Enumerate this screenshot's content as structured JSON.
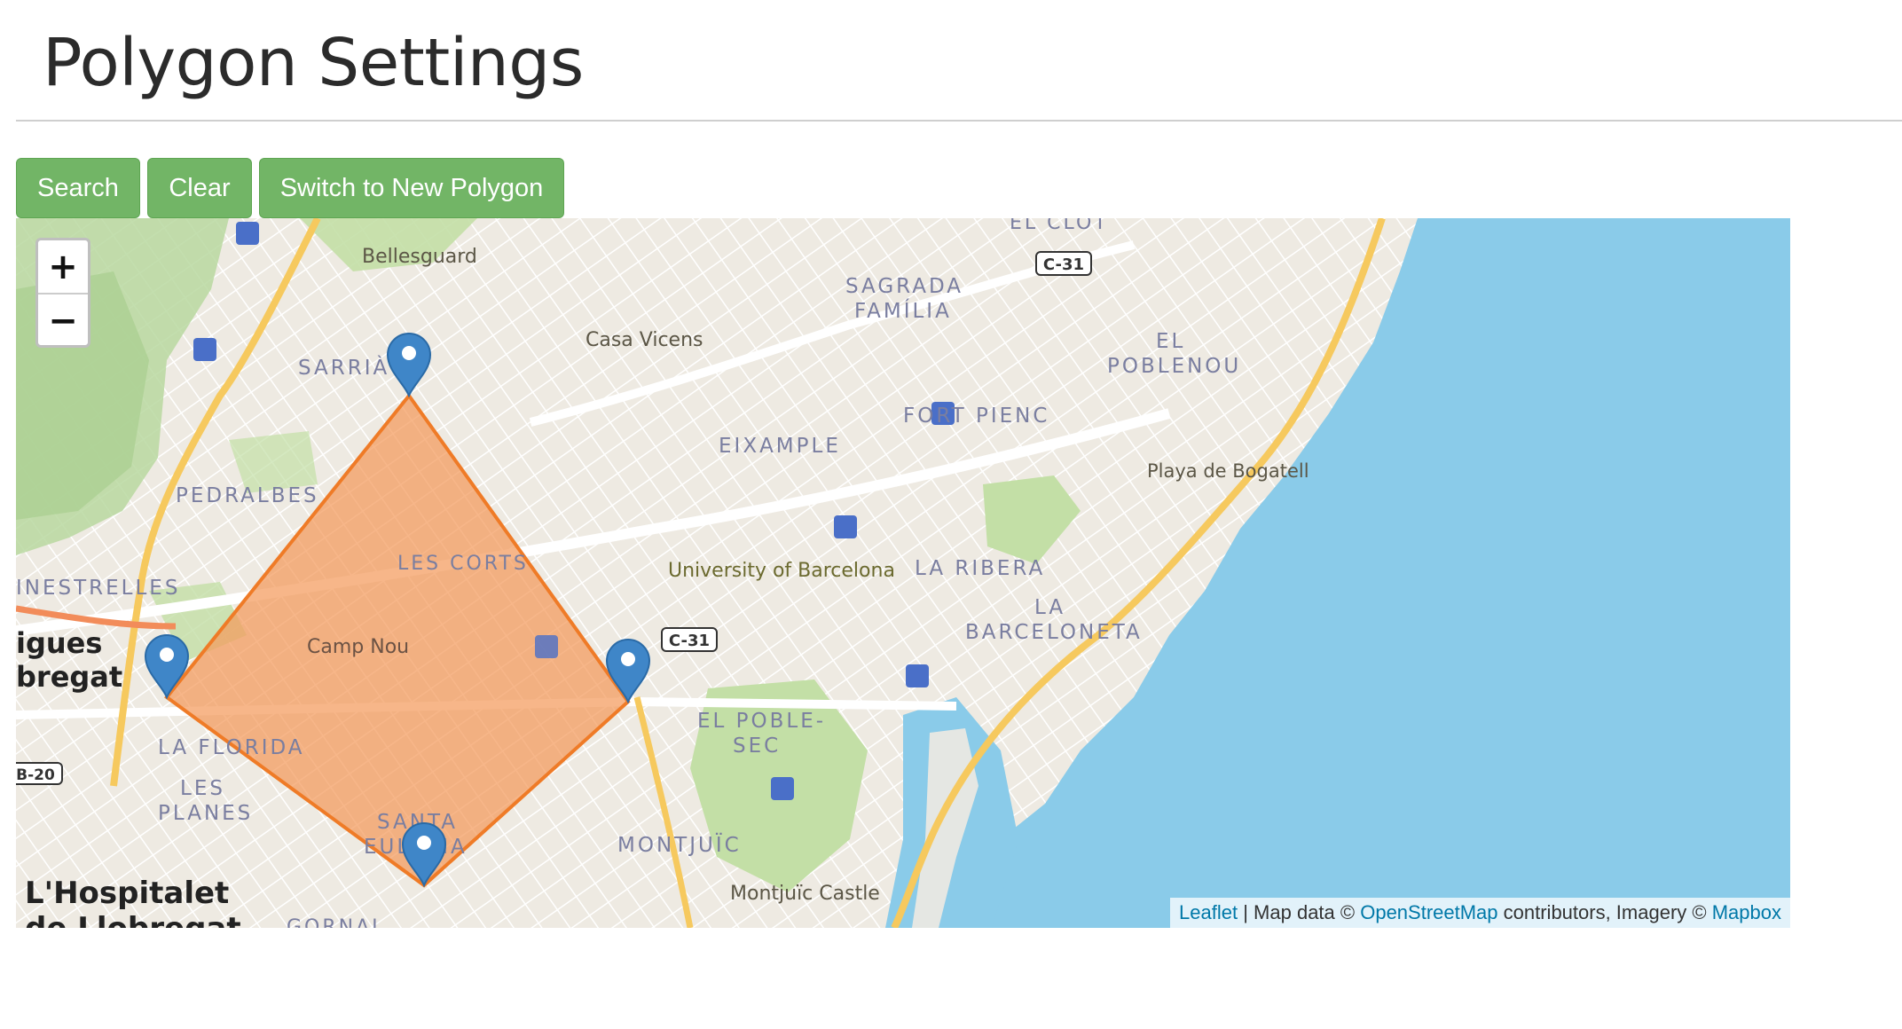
{
  "header": {
    "title": "Polygon Settings"
  },
  "toolbar": {
    "search_label": "Search",
    "clear_label": "Clear",
    "switch_label": "Switch to New Polygon"
  },
  "map": {
    "zoom_in": "+",
    "zoom_out": "−",
    "labels": {
      "bellesguard": "Bellesguard",
      "el_clot": "EL CLOT",
      "sagrada_1": "SAGRADA",
      "sagrada_2": "FAMÍLIA",
      "casa_vicens": "Casa Vicens",
      "sarria": "SARRIÀ",
      "el_poblenou_1": "EL",
      "el_poblenou_2": "POBLENOU",
      "fort_pienc": "FORT PIENC",
      "eixample": "EIXAMPLE",
      "playa": "Playa de Bogatell",
      "pedralbes": "PEDRALBES",
      "les_corts": "LES CORTS",
      "university": "University of Barcelona",
      "la_ribera": "LA RIBERA",
      "finestrelles": "INESTRELLES",
      "la_barceloneta_1": "LA",
      "la_barceloneta_2": "BARCELONETA",
      "camp_nou": "Camp Nou",
      "llobregat_1": "igues",
      "llobregat_2": "bregat",
      "el_poble_sec_1": "EL POBLE-",
      "el_poble_sec_2": "SEC",
      "la_florida": "LA FLORIDA",
      "les_planes_1": "LES",
      "les_planes_2": "PLANES",
      "montjuic": "MONTJUÏC",
      "montjuic_castle": "Montjuïc Castle",
      "santa_eulalia_1": "SANTA",
      "santa_eulalia_2": "EULÀLIA",
      "hospitalet_1": "L'Hospitalet",
      "hospitalet_2": "de Llobregat",
      "gornal": "GORNAL",
      "c31_a": "C-31",
      "c31_b": "C-31",
      "b20": "B-20"
    },
    "colors": {
      "water": "#8acbe9",
      "land": "#eeeae2",
      "park": "#c3dfa6",
      "road_major": "#f6c95e",
      "polygon_fill": "#f49a5c",
      "polygon_stroke": "#ef7b27",
      "marker": "#3f86c8",
      "transit": "#4a6fc8"
    }
  },
  "attribution": {
    "leaflet": "Leaflet",
    "sep1": " | Map data © ",
    "osm": "OpenStreetMap",
    "sep2": " contributors, Imagery © ",
    "mapbox": "Mapbox"
  }
}
